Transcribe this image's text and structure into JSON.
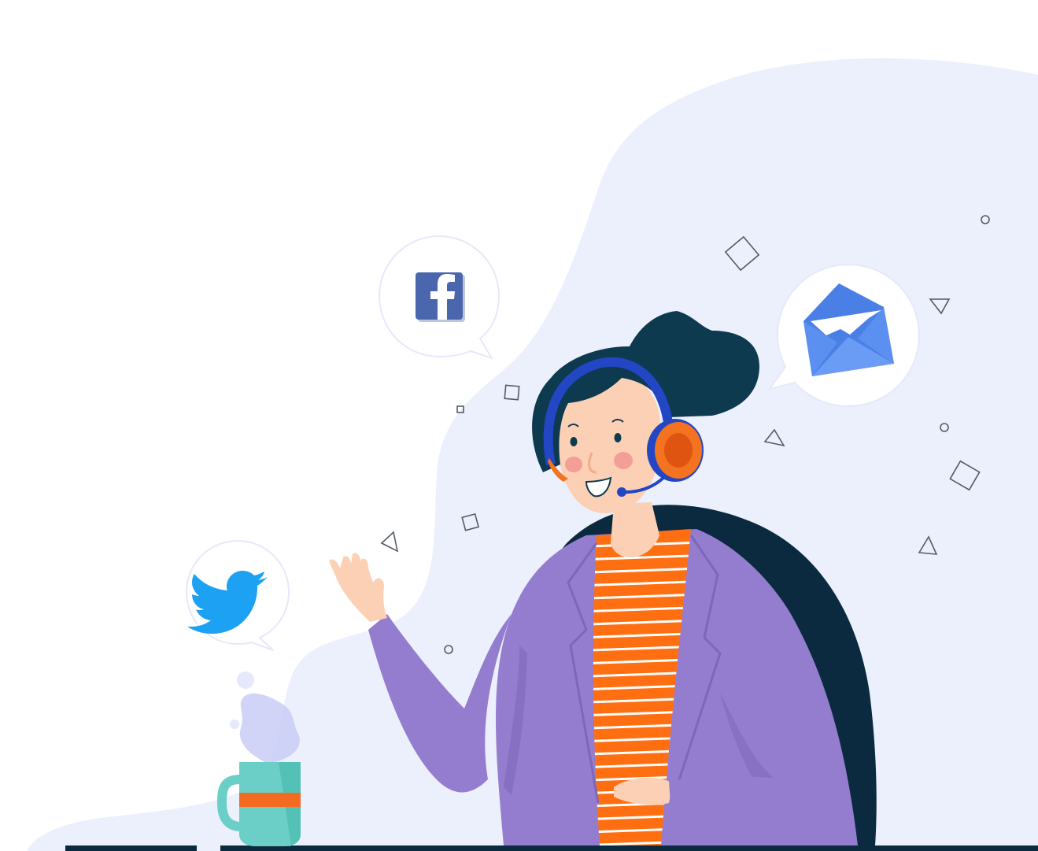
{
  "scene": {
    "description_free": true,
    "colors": {
      "background": "#ffffff",
      "blob": "#ebf0fc",
      "bubble_stroke": "#e6e8fb",
      "hair": "#0e3a4f",
      "chair": "#0b2a40",
      "blazer": "#947dcf",
      "blazer_shadow": "#7e66b8",
      "shirt_stripe_orange": "#ff6f12",
      "shirt_stripe_white": "#ffffff",
      "skin": "#fbd0b4",
      "headset_band": "#2346c4",
      "headset_cup": "#f47321",
      "headset_cup_inner": "#e05412",
      "facebook": "#4a67ad",
      "twitter": "#1da1f2",
      "mail": "#5b8ff0",
      "mug": "#6bcfc7",
      "mug_band": "#f26b21",
      "steam": "#c9ccf5",
      "desk": "#0b2a40",
      "outline_shapes": "#555b66"
    },
    "icons": [
      "facebook-icon",
      "twitter-icon",
      "mail-icon"
    ]
  }
}
